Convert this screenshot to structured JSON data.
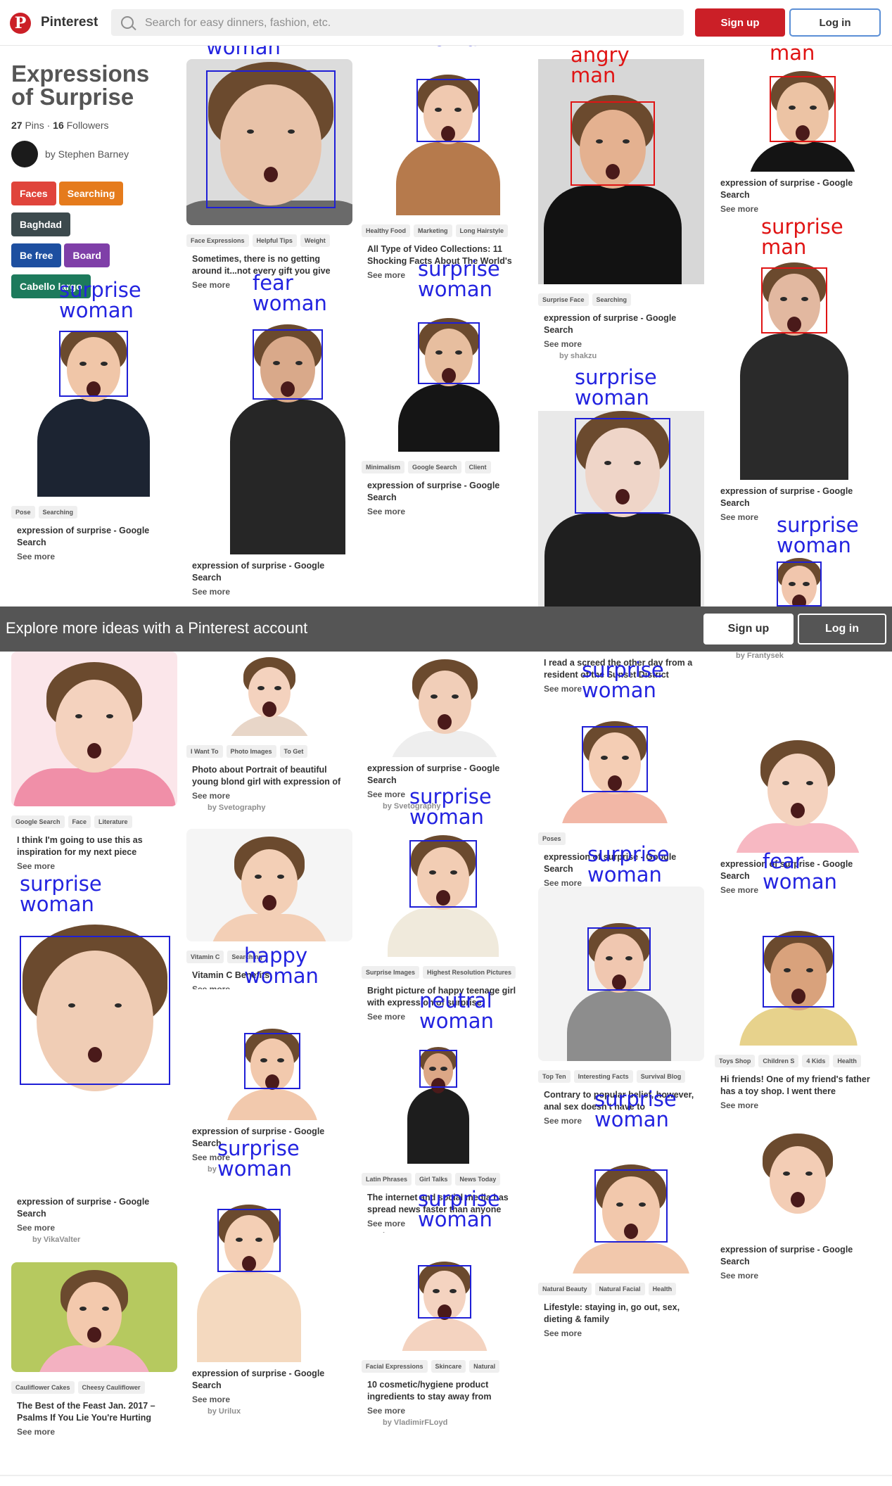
{
  "header": {
    "brand": "Pinterest",
    "search_placeholder": "Search for easy dinners, fashion, etc.",
    "signup_label": "Sign up",
    "login_label": "Log in"
  },
  "board": {
    "title": "Expressions of Surprise",
    "pins_count": "27",
    "pins_label": "Pins",
    "followers_count": "16",
    "followers_label": "Followers",
    "owner": "by Stephen Barney",
    "chips": [
      {
        "label": "Faces",
        "color": "#e0443b"
      },
      {
        "label": "Searching",
        "color": "#e57b1c"
      },
      {
        "label": "Baghdad",
        "color": "#3c4a4d"
      },
      {
        "label": "Be free",
        "color": "#1d4fa0"
      },
      {
        "label": "Board",
        "color": "#7f3fa8"
      },
      {
        "label": "Cabello largo",
        "color": "#1d7a5c"
      }
    ]
  },
  "pins": [
    {
      "label": "surprise woman",
      "red": false,
      "tags": [
        "Face Expressions",
        "Helpful Tips",
        "Weight"
      ],
      "desc": "Sometimes, there is no getting around it...not every gift you give",
      "see_more": "See more",
      "by": ""
    },
    {
      "label": "surprise woman",
      "red": false,
      "tags": [
        "Healthy Food",
        "Marketing",
        "Long Hairstyle"
      ],
      "desc": "All Type of Video Collections: 11 Shocking Facts About The World's",
      "see_more": "See more",
      "by": ""
    },
    {
      "label": "angry man",
      "red": true,
      "tags": [
        "Surprise Face",
        "Searching"
      ],
      "desc": "expression of surprise - Google Search",
      "see_more": "See more",
      "by": "by shakzu"
    },
    {
      "label": "fear man",
      "red": true,
      "tags": [],
      "desc": "expression of surprise - Google Search",
      "see_more": "See more",
      "by": ""
    },
    {
      "label": "surprise woman",
      "red": false,
      "tags": [
        "Pose",
        "Searching"
      ],
      "desc": "expression of surprise - Google Search",
      "see_more": "See more",
      "by": ""
    },
    {
      "label": "fear woman",
      "red": false,
      "tags": [],
      "desc": "expression of surprise - Google Search",
      "see_more": "See more",
      "by": ""
    },
    {
      "label": "surprise woman",
      "red": false,
      "tags": [
        "Minimalism",
        "Google Search",
        "Client"
      ],
      "desc": "expression of surprise - Google Search",
      "see_more": "See more",
      "by": ""
    },
    {
      "label": "surprise woman",
      "red": false,
      "tags": [],
      "desc": "",
      "see_more": "",
      "by": ""
    },
    {
      "label": "surprise man",
      "red": true,
      "tags": [],
      "desc": "expression of surprise - Google Search",
      "see_more": "See more",
      "by": ""
    },
    {
      "label": "surprise woman",
      "red": false,
      "tags": [],
      "desc": "expression of surprise - Google Search",
      "see_more": "See more",
      "by": "by Frantysek"
    },
    {
      "label": "",
      "red": false,
      "tags": [
        "Google Search",
        "Face",
        "Literature"
      ],
      "desc": "I think I'm going to use this as inspiration for my next piece",
      "see_more": "See more",
      "by": ""
    },
    {
      "label": "",
      "red": false,
      "tags": [
        "I Want To",
        "Photo Images",
        "To Get"
      ],
      "desc": "Photo about Portrait of beautiful young blond girl with expression of",
      "see_more": "See more",
      "by": "by Svetography"
    },
    {
      "label": "",
      "red": false,
      "tags": [],
      "desc": "expression of surprise - Google Search",
      "see_more": "See more",
      "by": "by Svetography"
    },
    {
      "label": "",
      "red": false,
      "tags": [],
      "desc": "I read a screed the other day from a resident of the Sunset District",
      "see_more": "See more",
      "by": ""
    },
    {
      "label": "surprise woman",
      "red": false,
      "tags": [
        "Poses"
      ],
      "desc": "expression of surprise - Google Search",
      "see_more": "See more",
      "by": ""
    },
    {
      "label": "",
      "red": false,
      "tags": [],
      "desc": "expression of surprise - Google Search",
      "see_more": "See more",
      "by": ""
    },
    {
      "label": "",
      "red": false,
      "tags": [
        "Vitamin C",
        "Searching"
      ],
      "desc": "Vitamin C Benefits",
      "see_more": "See more",
      "by": ""
    },
    {
      "label": "surprise woman",
      "red": false,
      "tags": [
        "Surprise Images",
        "Highest Resolution Pictures"
      ],
      "desc": "Bright picture of happy teenage girl with expression of surprise",
      "see_more": "See more",
      "by": ""
    },
    {
      "label": "surprise woman",
      "red": false,
      "tags": [
        "Top Ten",
        "Interesting Facts",
        "Survival Blog"
      ],
      "desc": "Contrary to popular belief, however, anal sex doesn't have to",
      "see_more": "See more",
      "by": ""
    },
    {
      "label": "fear woman",
      "red": false,
      "tags": [
        "Toys Shop",
        "Children S",
        "4 Kids",
        "Health"
      ],
      "desc": "Hi friends! One of my friend's father has a toy shop. I went there",
      "see_more": "See more",
      "by": ""
    },
    {
      "label": "surprise woman",
      "red": false,
      "tags": [],
      "desc": "expression of surprise - Google Search",
      "see_more": "See more",
      "by": "by VikaValter"
    },
    {
      "label": "happy woman",
      "red": false,
      "tags": [],
      "desc": "expression of surprise - Google Search",
      "see_more": "See more",
      "by": "by"
    },
    {
      "label": "neutral woman",
      "red": false,
      "tags": [
        "Latin Phrases",
        "Girl Talks",
        "News Today"
      ],
      "desc": "The internet and social media has spread news faster than anyone",
      "see_more": "See more",
      "by": "by warren"
    },
    {
      "label": "surprise woman",
      "red": false,
      "tags": [
        "Natural Beauty",
        "Natural Facial",
        "Health"
      ],
      "desc": "Lifestyle: staying in, go out, sex, dieting & family",
      "see_more": "See more",
      "by": ""
    },
    {
      "label": "",
      "red": false,
      "tags": [],
      "desc": "expression of surprise - Google Search",
      "see_more": "See more",
      "by": ""
    },
    {
      "label": "",
      "red": false,
      "tags": [
        "Cauliflower Cakes",
        "Cheesy Cauliflower"
      ],
      "desc": "The Best of the Feast Jan. 2017 – Psalms If You Lie You're Hurting",
      "see_more": "See more",
      "by": ""
    },
    {
      "label": "surprise woman",
      "red": false,
      "tags": [],
      "desc": "expression of surprise - Google Search",
      "see_more": "See more",
      "by": "by Urilux"
    },
    {
      "label": "surprise woman",
      "red": false,
      "tags": [
        "Facial Expressions",
        "Skincare",
        "Natural"
      ],
      "desc": "10 cosmetic/hygiene product ingredients to stay away from",
      "see_more": "See more",
      "by": "by VladimirFLoyd"
    }
  ],
  "explore": {
    "text": "Explore more ideas with a Pinterest account",
    "signup_label": "Sign up",
    "login_label": "Log in"
  }
}
